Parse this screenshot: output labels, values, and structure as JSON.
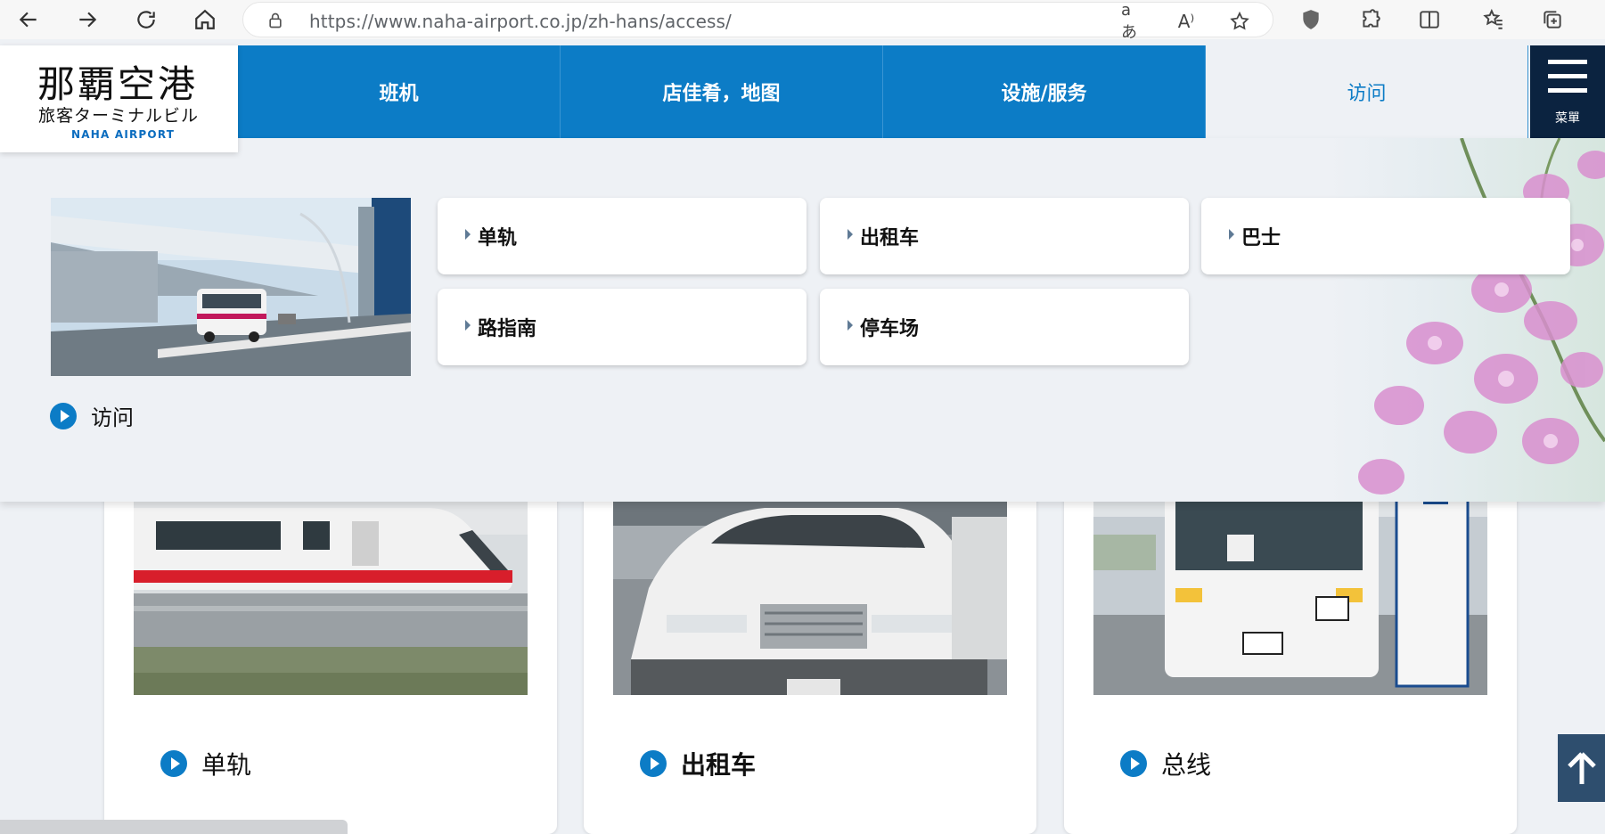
{
  "browser": {
    "url": "https://www.naha-airport.co.jp/zh-hans/access/",
    "icons": [
      "back-icon",
      "forward-icon",
      "reload-icon",
      "home-icon",
      "lock-icon",
      "read-aloud-icon",
      "aa-icon",
      "star-icon",
      "shield-icon",
      "extensions-icon",
      "split-screen-icon",
      "favorites-icon",
      "collections-icon"
    ],
    "read_aloud_glyph": "aあ",
    "font_glyph": "A⁾"
  },
  "logo": {
    "main": "那覇空港",
    "sub": "旅客ターミナルビル",
    "en": "NAHA AIRPORT"
  },
  "nav": {
    "items": [
      {
        "label": "班机"
      },
      {
        "label": "店佳肴，地图"
      },
      {
        "label": "设施/服务"
      },
      {
        "label": "访问"
      }
    ],
    "menu_label": "菜單"
  },
  "mega": {
    "section_link": "访问",
    "sub_items": [
      {
        "label": "单轨"
      },
      {
        "label": "出租车"
      },
      {
        "label": "巴士"
      },
      {
        "label": "路指南"
      },
      {
        "label": "停车场"
      }
    ]
  },
  "cards": [
    {
      "label": "单轨",
      "image": "monorail-photo"
    },
    {
      "label": "出租车",
      "image": "taxi-photo"
    },
    {
      "label": "总线",
      "image": "bus-photo"
    }
  ],
  "colors": {
    "brand_blue": "#0c7cc6",
    "navy": "#0b2340",
    "background": "#eef1f5"
  }
}
